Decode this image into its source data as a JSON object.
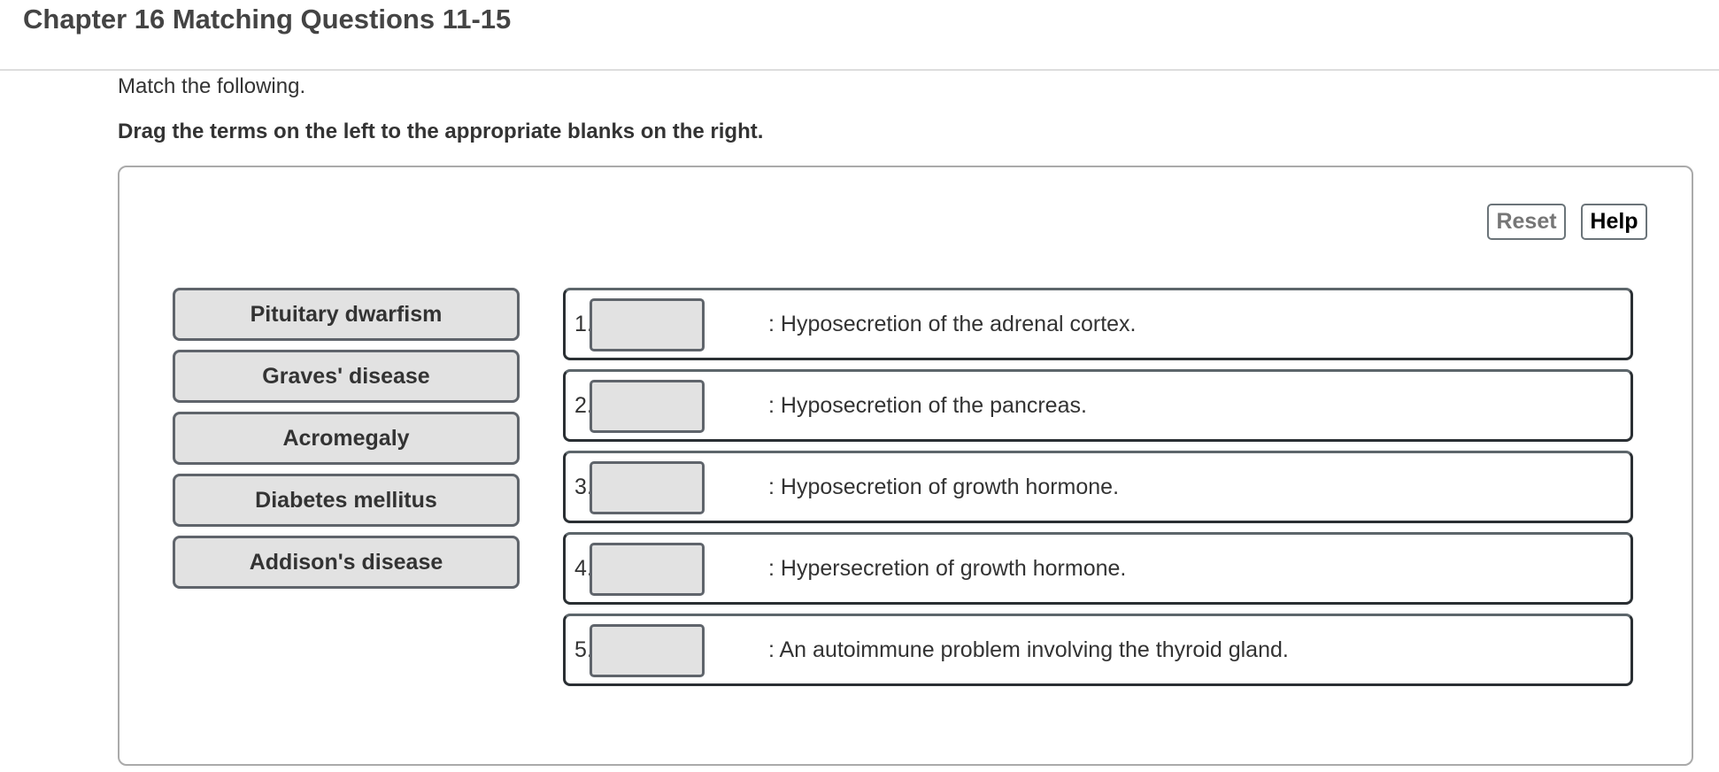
{
  "page": {
    "title": "Chapter 16 Matching Questions 11-15",
    "intro": "Match the following.",
    "instructions": "Drag the terms on the left to the appropriate blanks on the right."
  },
  "toolbar": {
    "reset_label": "Reset",
    "help_label": "Help"
  },
  "terms": [
    {
      "label": "Pituitary dwarfism"
    },
    {
      "label": "Graves' disease"
    },
    {
      "label": "Acromegaly"
    },
    {
      "label": "Diabetes mellitus"
    },
    {
      "label": "Addison's disease"
    }
  ],
  "targets": [
    {
      "number": "1.",
      "value": "",
      "description": ": Hyposecretion of the adrenal cortex."
    },
    {
      "number": "2.",
      "value": "",
      "description": ": Hyposecretion of the pancreas."
    },
    {
      "number": "3.",
      "value": "",
      "description": ": Hyposecretion of growth hormone."
    },
    {
      "number": "4.",
      "value": "",
      "description": ": Hypersecretion of growth hormone."
    },
    {
      "number": "5.",
      "value": "",
      "description": ": An autoimmune problem involving the thyroid gland."
    }
  ],
  "colors": {
    "term_bg": "#e2e2e2",
    "border_dark": "#2a2f33",
    "reset_text": "#767676"
  }
}
